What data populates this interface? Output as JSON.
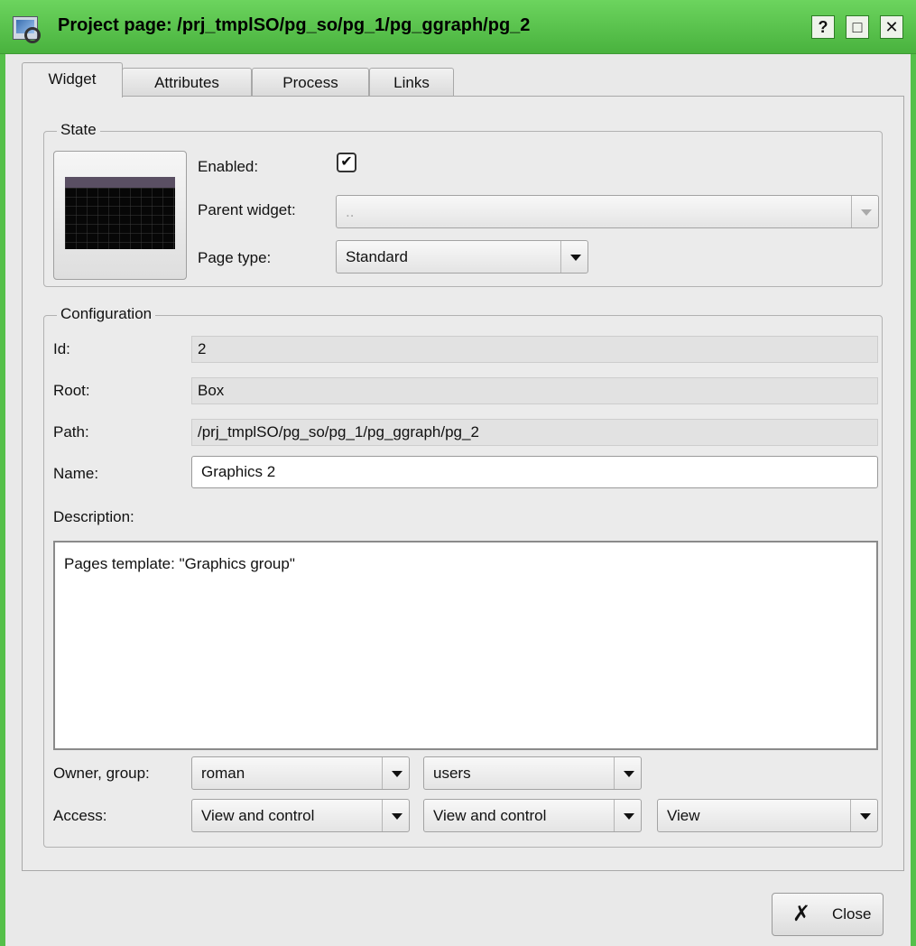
{
  "window": {
    "title": "Project page: /prj_tmplSO/pg_so/pg_1/pg_ggraph/pg_2",
    "help_button": "?",
    "maximize_button": "□",
    "close_button": "✕"
  },
  "tabs": [
    {
      "label": "Widget",
      "active": true
    },
    {
      "label": "Attributes",
      "active": false
    },
    {
      "label": "Process",
      "active": false
    },
    {
      "label": "Links",
      "active": false
    }
  ],
  "state": {
    "title": "State",
    "enabled_label": "Enabled:",
    "enabled_checked": true,
    "parent_widget_label": "Parent widget:",
    "parent_widget_value": "..",
    "page_type_label": "Page type:",
    "page_type_value": "Standard"
  },
  "configuration": {
    "title": "Configuration",
    "id_label": "Id:",
    "id_value": "2",
    "root_label": "Root:",
    "root_value": "Box",
    "path_label": "Path:",
    "path_value": "/prj_tmplSO/pg_so/pg_1/pg_ggraph/pg_2",
    "name_label": "Name:",
    "name_value": "Graphics 2",
    "description_label": "Description:",
    "description_value": "Pages template: \"Graphics group\"",
    "owner_group_label": "Owner, group:",
    "owner_value": "roman",
    "group_value": "users",
    "access_label": "Access:",
    "access_owner": "View and control",
    "access_group": "View and control",
    "access_other": "View"
  },
  "footer": {
    "close_label": "Close",
    "close_icon": "x-icon"
  },
  "colors": {
    "titlebar": "#55c04a",
    "window_bg": "#e9e9e9"
  }
}
